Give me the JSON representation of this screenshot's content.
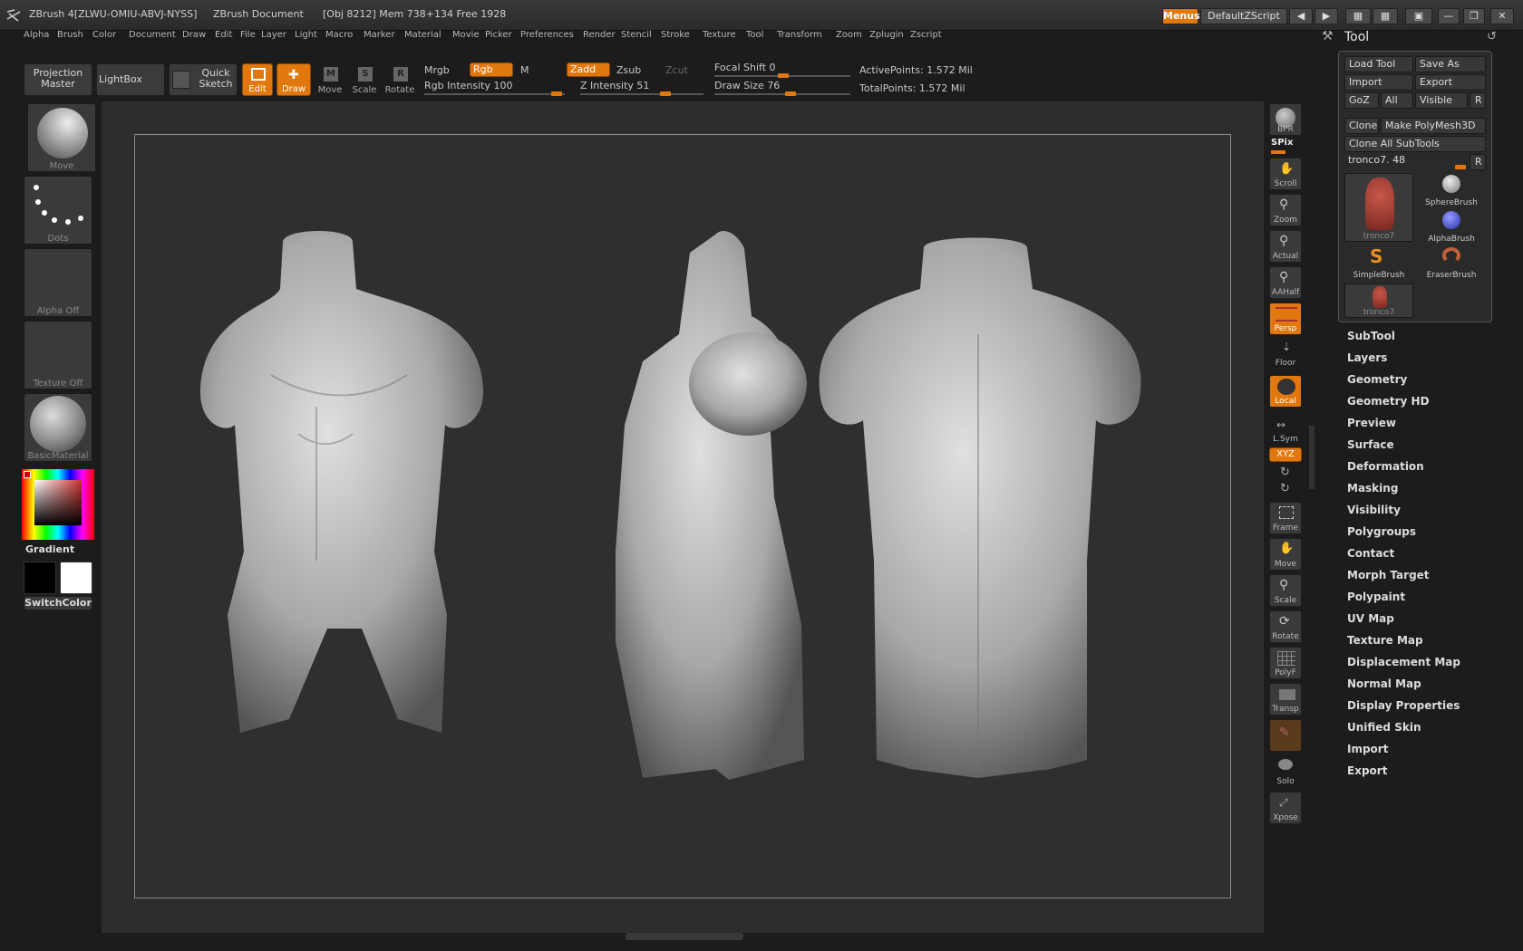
{
  "titlebar": {
    "app": "ZBrush 4[ZLWU-OMIU-ABVJ-NYSS]",
    "doc": "ZBrush Document",
    "stats": "[Obj 8212] Mem 738+134 Free 1928",
    "menus_btn": "Menus",
    "script": "DefaultZScript"
  },
  "menubar": [
    "Alpha",
    "Brush",
    "Color",
    "Document",
    "Draw",
    "Edit",
    "File",
    "Layer",
    "Light",
    "Macro",
    "Marker",
    "Material",
    "Movie",
    "Picker",
    "Preferences",
    "Render",
    "Stencil",
    "Stroke",
    "Texture",
    "Tool",
    "Transform",
    "Zoom",
    "Zplugin",
    "Zscript"
  ],
  "shelf": {
    "projection_master": "Projection Master",
    "lightbox": "LightBox",
    "quick_sketch": "Quick Sketch",
    "edit": "Edit",
    "draw": "Draw",
    "move": "Move",
    "scale": "Scale",
    "rotate": "Rotate",
    "mrgb": "Mrgb",
    "rgb": "Rgb",
    "m": "M",
    "zadd": "Zadd",
    "zsub": "Zsub",
    "zcut": "Zcut",
    "rgb_intensity_label": "Rgb Intensity",
    "rgb_intensity": "100",
    "z_intensity_label": "Z Intensity",
    "z_intensity": "51",
    "focal_shift_label": "Focal Shift",
    "focal_shift": "0",
    "draw_size_label": "Draw Size",
    "draw_size": "76",
    "active_points": "ActivePoints: 1.572 Mil",
    "total_points": "TotalPoints: 1.572 Mil"
  },
  "leftpanel": {
    "brush": "Move",
    "stroke": "Dots",
    "alpha": "Alpha Off",
    "texture": "Texture Off",
    "material": "BasicMaterial",
    "gradient": "Gradient",
    "switchcolor": "SwitchColor"
  },
  "righttoolbar": [
    "BPR",
    "SPix",
    "Scroll",
    "Zoom",
    "Actual",
    "AAHalf",
    "Persp",
    "Floor",
    "Local",
    "L.Sym",
    "XYZ",
    "",
    "",
    "Frame",
    "Move",
    "Scale",
    "Rotate",
    "PolyF",
    "Transp",
    "",
    "Solo",
    "Xpose"
  ],
  "toolpalette": {
    "title": "Tool",
    "load_tool": "Load Tool",
    "save_as": "Save As",
    "import": "Import",
    "export": "Export",
    "goz": "GoZ",
    "all": "All",
    "visible": "Visible",
    "r": "R",
    "clone": "Clone",
    "make_polymesh": "Make PolyMesh3D",
    "clone_all": "Clone All SubTools",
    "tool_slider": "tronco7. 48",
    "tools": [
      "tronco7",
      "SphereBrush",
      "AlphaBrush",
      "SimpleBrush",
      "EraserBrush",
      "tronco7"
    ]
  },
  "toolmenu": [
    "SubTool",
    "Layers",
    "Geometry",
    "Geometry HD",
    "Preview",
    "Surface",
    "Deformation",
    "Masking",
    "Visibility",
    "Polygroups",
    "Contact",
    "Morph Target",
    "Polypaint",
    "UV Map",
    "Texture Map",
    "Displacement Map",
    "Normal Map",
    "Display Properties",
    "Unified Skin",
    "Import",
    "Export"
  ],
  "colors": {
    "accent": "#e0780f",
    "bg": "#2d2d2d"
  }
}
